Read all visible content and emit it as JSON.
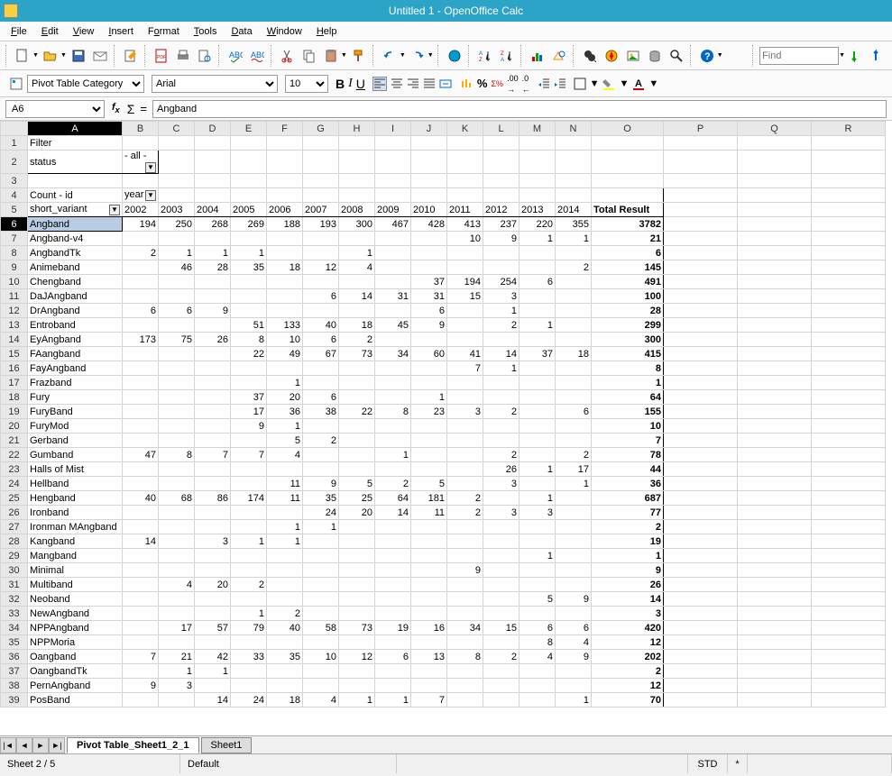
{
  "title": "Untitled 1 - OpenOffice Calc",
  "menu": [
    "File",
    "Edit",
    "View",
    "Insert",
    "Format",
    "Tools",
    "Data",
    "Window",
    "Help"
  ],
  "find_placeholder": "Find",
  "style_name": "Pivot Table Category",
  "font_name": "Arial",
  "font_size": "10",
  "cell_ref": "A6",
  "cell_content": "Angband",
  "columns": [
    "A",
    "B",
    "C",
    "D",
    "E",
    "F",
    "G",
    "H",
    "I",
    "J",
    "K",
    "L",
    "M",
    "N",
    "O",
    "P",
    "Q",
    "R"
  ],
  "filter_label": "Filter",
  "status_label": "status",
  "status_value": "- all -",
  "count_label": "Count - id",
  "year_label": "year",
  "variant_label": "short_variant",
  "years": [
    "2002",
    "2003",
    "2004",
    "2005",
    "2006",
    "2007",
    "2008",
    "2009",
    "2010",
    "2011",
    "2012",
    "2013",
    "2014"
  ],
  "total_label": "Total Result",
  "rows": [
    {
      "n": "Angband",
      "v": [
        "194",
        "250",
        "268",
        "269",
        "188",
        "193",
        "300",
        "467",
        "428",
        "413",
        "237",
        "220",
        "355"
      ],
      "t": "3782",
      "sel": true
    },
    {
      "n": "Angband-v4",
      "v": [
        "",
        "",
        "",
        "",
        "",
        "",
        "",
        "",
        "",
        "10",
        "9",
        "1",
        "1"
      ],
      "t": "21"
    },
    {
      "n": "AngbandTk",
      "v": [
        "2",
        "1",
        "1",
        "1",
        "",
        "",
        "1",
        "",
        "",
        "",
        "",
        "",
        ""
      ],
      "t": "6"
    },
    {
      "n": "Animeband",
      "v": [
        "",
        "46",
        "28",
        "35",
        "18",
        "12",
        "4",
        "",
        "",
        "",
        "",
        "",
        "2"
      ],
      "t": "145"
    },
    {
      "n": "Chengband",
      "v": [
        "",
        "",
        "",
        "",
        "",
        "",
        "",
        "",
        "37",
        "194",
        "254",
        "6",
        ""
      ],
      "t": "491"
    },
    {
      "n": "DaJAngband",
      "v": [
        "",
        "",
        "",
        "",
        "",
        "6",
        "14",
        "31",
        "31",
        "15",
        "3",
        "",
        ""
      ],
      "t": "100"
    },
    {
      "n": "DrAngband",
      "v": [
        "6",
        "6",
        "9",
        "",
        "",
        "",
        "",
        "",
        "6",
        "",
        "1",
        "",
        ""
      ],
      "t": "28"
    },
    {
      "n": "Entroband",
      "v": [
        "",
        "",
        "",
        "51",
        "133",
        "40",
        "18",
        "45",
        "9",
        "",
        "2",
        "1",
        ""
      ],
      "t": "299"
    },
    {
      "n": "EyAngband",
      "v": [
        "173",
        "75",
        "26",
        "8",
        "10",
        "6",
        "2",
        "",
        "",
        "",
        "",
        "",
        ""
      ],
      "t": "300"
    },
    {
      "n": "FAangband",
      "v": [
        "",
        "",
        "",
        "22",
        "49",
        "67",
        "73",
        "34",
        "60",
        "41",
        "14",
        "37",
        "18"
      ],
      "t": "415"
    },
    {
      "n": "FayAngband",
      "v": [
        "",
        "",
        "",
        "",
        "",
        "",
        "",
        "",
        "",
        "7",
        "1",
        "",
        ""
      ],
      "t": "8"
    },
    {
      "n": "Frazband",
      "v": [
        "",
        "",
        "",
        "",
        "1",
        "",
        "",
        "",
        "",
        "",
        "",
        "",
        ""
      ],
      "t": "1"
    },
    {
      "n": "Fury",
      "v": [
        "",
        "",
        "",
        "37",
        "20",
        "6",
        "",
        "",
        "1",
        "",
        "",
        "",
        ""
      ],
      "t": "64"
    },
    {
      "n": "FuryBand",
      "v": [
        "",
        "",
        "",
        "17",
        "36",
        "38",
        "22",
        "8",
        "23",
        "3",
        "2",
        "",
        "6"
      ],
      "t": "155"
    },
    {
      "n": "FuryMod",
      "v": [
        "",
        "",
        "",
        "9",
        "1",
        "",
        "",
        "",
        "",
        "",
        "",
        "",
        ""
      ],
      "t": "10"
    },
    {
      "n": "Gerband",
      "v": [
        "",
        "",
        "",
        "",
        "5",
        "2",
        "",
        "",
        "",
        "",
        "",
        "",
        ""
      ],
      "t": "7"
    },
    {
      "n": "Gumband",
      "v": [
        "47",
        "8",
        "7",
        "7",
        "4",
        "",
        "",
        "1",
        "",
        "",
        "2",
        "",
        "2"
      ],
      "t": "78"
    },
    {
      "n": "Halls of Mist",
      "v": [
        "",
        "",
        "",
        "",
        "",
        "",
        "",
        "",
        "",
        "",
        "26",
        "1",
        "17"
      ],
      "t": "44"
    },
    {
      "n": "Hellband",
      "v": [
        "",
        "",
        "",
        "",
        "11",
        "9",
        "5",
        "2",
        "5",
        "",
        "3",
        "",
        "1"
      ],
      "t": "36"
    },
    {
      "n": "Hengband",
      "v": [
        "40",
        "68",
        "86",
        "174",
        "11",
        "35",
        "25",
        "64",
        "181",
        "2",
        "",
        "1",
        ""
      ],
      "t": "687"
    },
    {
      "n": "Ironband",
      "v": [
        "",
        "",
        "",
        "",
        "",
        "24",
        "20",
        "14",
        "11",
        "2",
        "3",
        "3",
        ""
      ],
      "t": "77"
    },
    {
      "n": "Ironman MAngband",
      "v": [
        "",
        "",
        "",
        "",
        "1",
        "1",
        "",
        "",
        "",
        "",
        "",
        "",
        ""
      ],
      "t": "2"
    },
    {
      "n": "Kangband",
      "v": [
        "14",
        "",
        "3",
        "1",
        "1",
        "",
        "",
        "",
        "",
        "",
        "",
        "",
        ""
      ],
      "t": "19"
    },
    {
      "n": "Mangband",
      "v": [
        "",
        "",
        "",
        "",
        "",
        "",
        "",
        "",
        "",
        "",
        "",
        "1",
        ""
      ],
      "t": "1"
    },
    {
      "n": "Minimal",
      "v": [
        "",
        "",
        "",
        "",
        "",
        "",
        "",
        "",
        "",
        "9",
        "",
        "",
        ""
      ],
      "t": "9"
    },
    {
      "n": "Multiband",
      "v": [
        "",
        "4",
        "20",
        "2",
        "",
        "",
        "",
        "",
        "",
        "",
        "",
        "",
        ""
      ],
      "t": "26"
    },
    {
      "n": "Neoband",
      "v": [
        "",
        "",
        "",
        "",
        "",
        "",
        "",
        "",
        "",
        "",
        "",
        "5",
        "9"
      ],
      "t": "14"
    },
    {
      "n": "NewAngband",
      "v": [
        "",
        "",
        "",
        "1",
        "2",
        "",
        "",
        "",
        "",
        "",
        "",
        "",
        ""
      ],
      "t": "3"
    },
    {
      "n": "NPPAngband",
      "v": [
        "",
        "17",
        "57",
        "79",
        "40",
        "58",
        "73",
        "19",
        "16",
        "34",
        "15",
        "6",
        "6"
      ],
      "t": "420"
    },
    {
      "n": "NPPMoria",
      "v": [
        "",
        "",
        "",
        "",
        "",
        "",
        "",
        "",
        "",
        "",
        "",
        "8",
        "4"
      ],
      "t": "12"
    },
    {
      "n": "Oangband",
      "v": [
        "7",
        "21",
        "42",
        "33",
        "35",
        "10",
        "12",
        "6",
        "13",
        "8",
        "2",
        "4",
        "9"
      ],
      "t": "202"
    },
    {
      "n": "OangbandTk",
      "v": [
        "",
        "1",
        "1",
        "",
        "",
        "",
        "",
        "",
        "",
        "",
        "",
        "",
        ""
      ],
      "t": "2"
    },
    {
      "n": "PernAngband",
      "v": [
        "9",
        "3",
        "",
        "",
        "",
        "",
        "",
        "",
        "",
        "",
        "",
        "",
        ""
      ],
      "t": "12"
    },
    {
      "n": "PosBand",
      "v": [
        "",
        "",
        "14",
        "24",
        "18",
        "4",
        "1",
        "1",
        "7",
        "",
        "",
        "",
        "1"
      ],
      "t": "70"
    }
  ],
  "tabs": [
    "Pivot Table_Sheet1_2_1",
    "Sheet1"
  ],
  "status_sheet": "Sheet 2 / 5",
  "status_default": "Default",
  "status_mode": "STD",
  "status_star": "*"
}
